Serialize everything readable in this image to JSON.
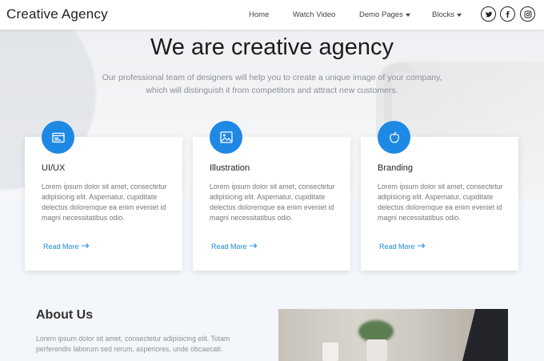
{
  "navbar": {
    "brand": "Creative Agency",
    "items": [
      {
        "label": "Home"
      },
      {
        "label": "Watch Video"
      },
      {
        "label": "Demo Pages"
      },
      {
        "label": "Blocks"
      }
    ],
    "social": [
      "twitter-icon",
      "facebook-icon",
      "instagram-icon"
    ]
  },
  "hero": {
    "title": "We are creative agency",
    "subtitle_line1": "Our professional team of designers will help you to create a unique image of your company,",
    "subtitle_line2": "which will distinguish it from competitors and attract new customers."
  },
  "cards": [
    {
      "icon": "browser-window-icon",
      "title": "UI/UX",
      "text": "Lorem ipsum dolor sit amet, consectetur adipisicing elit. Aspernatur, cupiditate delectus doloremque ea enim eveniet id magni necessitatibus odio.",
      "link": "Read More"
    },
    {
      "icon": "image-icon",
      "title": "Illustration",
      "text": "Lorem ipsum dolor sit amet, consectetur adipisicing elit. Aspernatur, cupiditate delectus doloremque ea enim eveniet id magni necessitatibus odio.",
      "link": "Read More"
    },
    {
      "icon": "apple-icon",
      "title": "Branding",
      "text": "Lorem ipsum dolor sit amet, consectetur adipisicing elit. Aspernatur, cupiditate delectus doloremque ea enim eveniet id magni necessitatibus odio.",
      "link": "Read More"
    }
  ],
  "about": {
    "title": "About Us",
    "text": "Lorem ipsum dolor sit amet, consectetur adipisicing elit. Totam perferendis laborum sed rerum, asperiores, unde obcaecati."
  },
  "colors": {
    "accent": "#1e88e5",
    "background": "#f3f6fa",
    "card": "#ffffff"
  }
}
